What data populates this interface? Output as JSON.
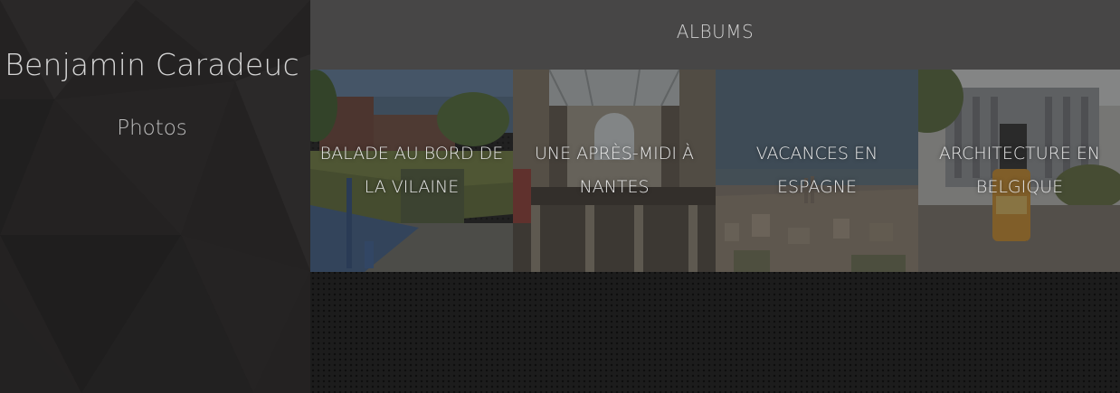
{
  "sidebar": {
    "title": "Benjamin Caradeuc",
    "nav": [
      {
        "label": "Photos"
      }
    ]
  },
  "header": {
    "title": "ALBUMS"
  },
  "albums": [
    {
      "label": "BALADE AU BORD DE LA VILAINE"
    },
    {
      "label": "UNE APRÈS-MIDI À NANTES"
    },
    {
      "label": "VACANCES EN ESPAGNE"
    },
    {
      "label": "ARCHITECTURE EN BELGIQUE"
    }
  ],
  "colors": {
    "sidebar_bg": "#242222",
    "header_bg": "#474646",
    "content_bg": "#1c1c1c",
    "text_light": "#d4d4d4"
  }
}
